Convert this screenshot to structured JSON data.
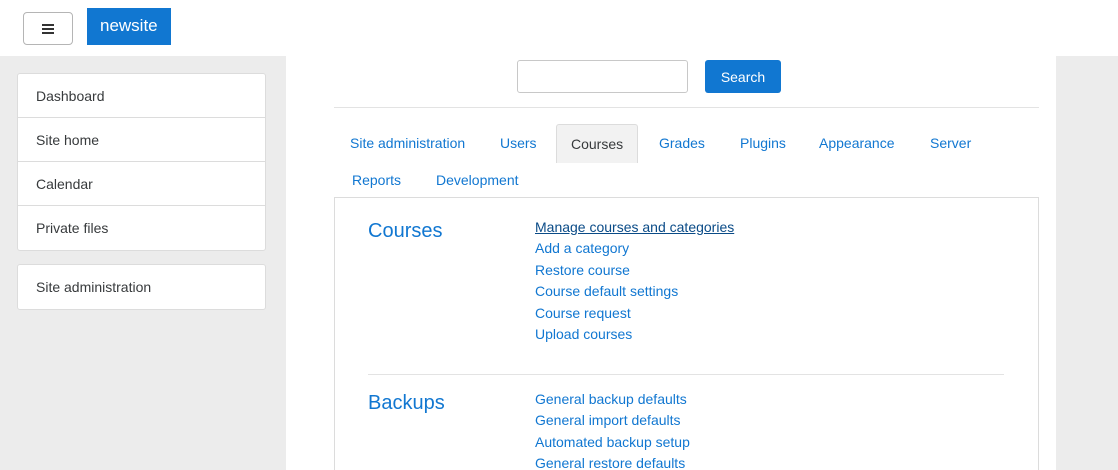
{
  "navbar": {
    "menu_icon": "hamburger-icon",
    "brand": "newsite"
  },
  "sidebar": {
    "items": [
      {
        "label": "Dashboard"
      },
      {
        "label": "Site home"
      },
      {
        "label": "Calendar"
      },
      {
        "label": "Private files"
      }
    ],
    "admin_item": {
      "label": "Site administration"
    }
  },
  "search": {
    "value": "",
    "placeholder": "",
    "button_label": "Search"
  },
  "tabs": [
    {
      "label": "Site administration",
      "active": false
    },
    {
      "label": "Users",
      "active": false
    },
    {
      "label": "Courses",
      "active": true
    },
    {
      "label": "Grades",
      "active": false
    },
    {
      "label": "Plugins",
      "active": false
    },
    {
      "label": "Appearance",
      "active": false
    },
    {
      "label": "Server",
      "active": false
    },
    {
      "label": "Reports",
      "active": false
    },
    {
      "label": "Development",
      "active": false
    }
  ],
  "sections": [
    {
      "title": "Courses",
      "links": [
        "Manage courses and categories",
        "Add a category",
        "Restore course",
        "Course default settings",
        "Course request",
        "Upload courses"
      ]
    },
    {
      "title": "Backups",
      "links": [
        "General backup defaults",
        "General import defaults",
        "Automated backup setup",
        "General restore defaults"
      ]
    }
  ],
  "colors": {
    "brand": "#1177d1",
    "link": "#1177d1",
    "sidebar_bg": "#ececec"
  }
}
